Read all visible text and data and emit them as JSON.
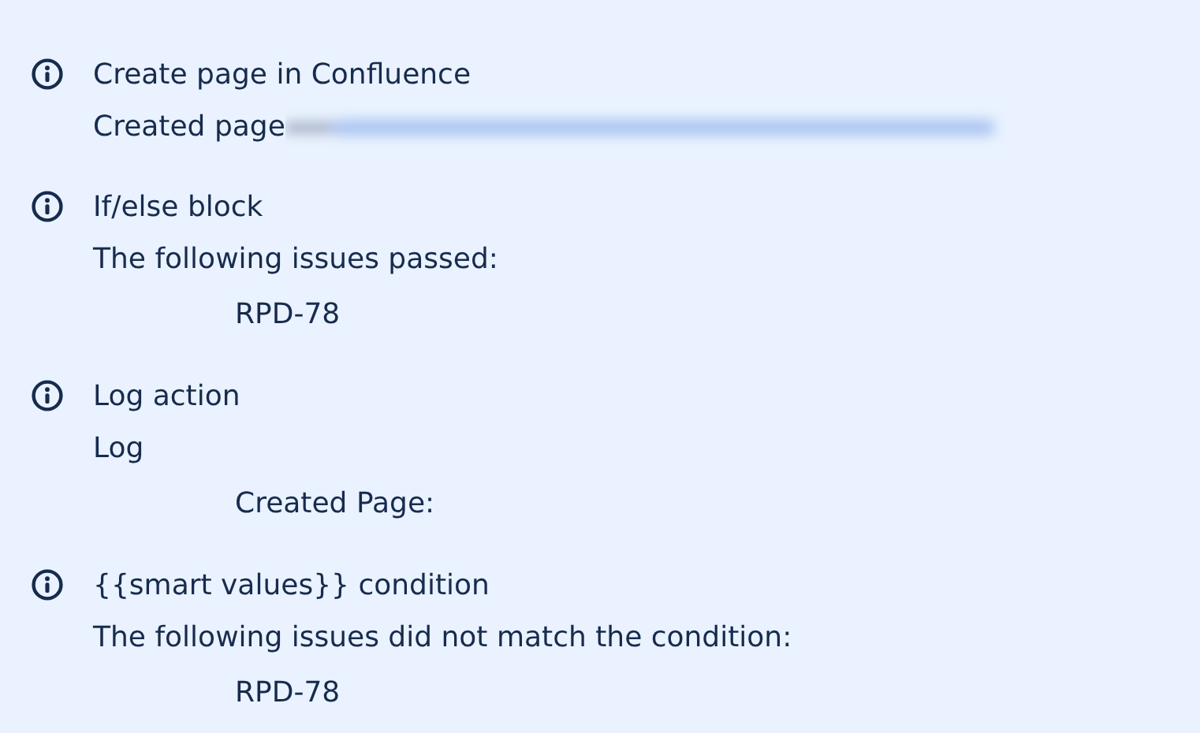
{
  "entries": [
    {
      "title": "Create page in Confluence",
      "detail": "Created page",
      "redacted": true
    },
    {
      "title": "If/else block",
      "detail": "The following issues passed:",
      "items": [
        "RPD-78"
      ]
    },
    {
      "title": "Log action",
      "detail": "Log",
      "items": [
        "Created Page:"
      ]
    },
    {
      "title": "{{smart values}} condition",
      "detail": "The following issues did not match the condition:",
      "items": [
        "RPD-78"
      ]
    }
  ]
}
